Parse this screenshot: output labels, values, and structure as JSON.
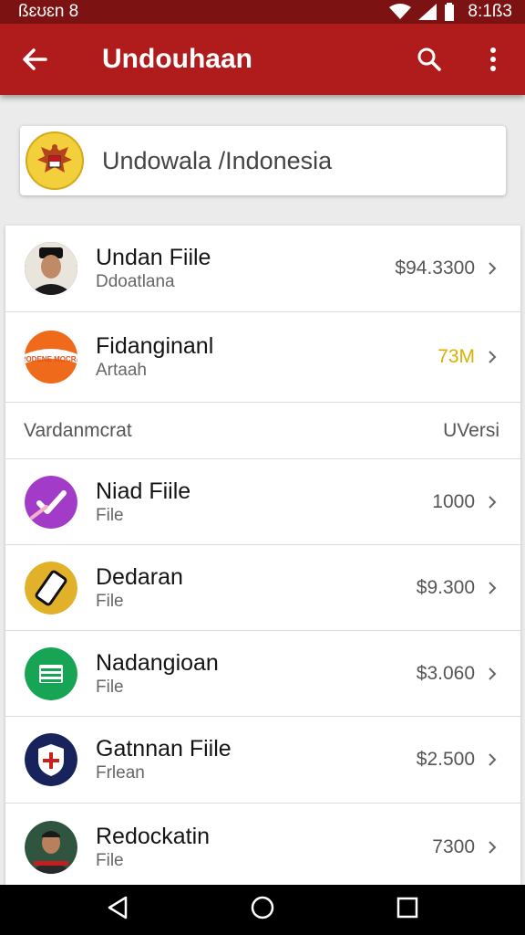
{
  "status_bar": {
    "left_text": "ßɛʊɛn 8",
    "time": "8:1ß3",
    "icons": [
      "wifi-icon",
      "signal-icon",
      "battery-icon"
    ]
  },
  "app_bar": {
    "title": "Undouhaan",
    "icons": [
      "back-arrow-icon",
      "search-icon",
      "more-vert-icon"
    ]
  },
  "banner": {
    "text": "Undowala /Indonesia",
    "icon": "garuda-emblem-icon"
  },
  "items_top": [
    {
      "title": "Undan Fiile",
      "subtitle": "Ddoatlana",
      "value": "$94.3300",
      "icon": "person-avatar"
    },
    {
      "title": "Fidanginanl",
      "subtitle": "Artaah",
      "value": "73M",
      "value_color": "#d8b000",
      "icon": "orange-logo-avatar",
      "logo_text": "RODENE MOCRA"
    }
  ],
  "section": {
    "left": "Vardanmcrat",
    "right": "UVersi"
  },
  "items": [
    {
      "title": "Niad Fiile",
      "subtitle": "File",
      "value": "1000",
      "icon": "purple-check-icon"
    },
    {
      "title": "Dedaran",
      "subtitle": "File",
      "value": "$9.300",
      "icon": "phone-icon"
    },
    {
      "title": "Nadangioan",
      "subtitle": "File",
      "value": "$3.060",
      "icon": "green-doc-icon"
    },
    {
      "title": "Gatnnan Fiile",
      "subtitle": "Frlean",
      "value": "$2.500",
      "icon": "shield-plus-icon"
    },
    {
      "title": "Redockatin",
      "subtitle": "File",
      "value": "7300",
      "icon": "person-avatar-2"
    }
  ],
  "nav_bar": {
    "icons": [
      "nav-back-icon",
      "nav-home-icon",
      "nav-recents-icon"
    ]
  },
  "colors": {
    "status_bar": "#7d1212",
    "app_bar": "#b01c1c",
    "accent_value": "#d8b000"
  }
}
